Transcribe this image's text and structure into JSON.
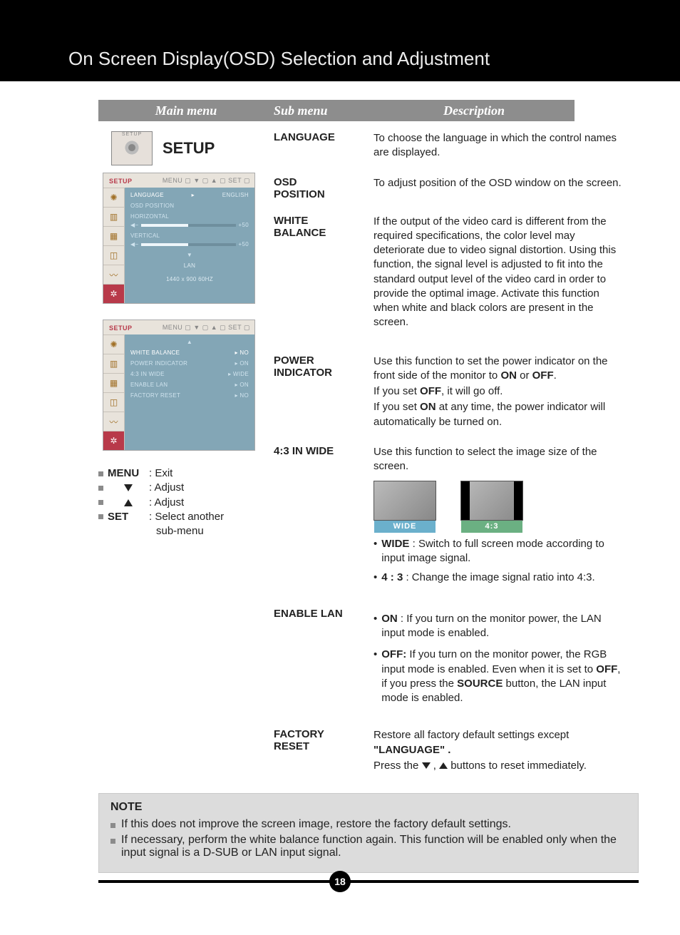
{
  "banner_title": "On Screen Display(OSD) Selection and Adjustment",
  "columns": {
    "main": "Main menu",
    "sub": "Sub menu",
    "desc": "Description"
  },
  "setup": {
    "icon_label": "SETUP",
    "title": "SETUP",
    "panel1": {
      "title": "SETUP",
      "nav": "MENU ▢  ▼ ▢  ▲ ▢  SET ▢",
      "rows": {
        "language": {
          "label": "LANGUAGE",
          "value": "ENGLISH"
        },
        "osd_position": "OSD  POSITION",
        "horizontal": "HORIZONTAL",
        "h_val": "50",
        "vertical": "VERTICAL",
        "v_val": "50",
        "lan": "LAN",
        "res": "1440 x 900  60HZ"
      }
    },
    "panel2": {
      "title": "SETUP",
      "nav": "MENU ▢  ▼ ▢  ▲ ▢  SET ▢",
      "rows": {
        "white_balance": {
          "label": "WHITE  BALANCE",
          "value": "NO"
        },
        "power_indicator": {
          "label": "POWER  INDICATOR",
          "value": "ON"
        },
        "ratio": {
          "label": "4:3 IN WIDE",
          "value": "WIDE"
        },
        "enable_lan": {
          "label": "ENABLE  LAN",
          "value": "ON"
        },
        "factory_reset": {
          "label": "FACTORY  RESET",
          "value": "NO"
        }
      }
    },
    "legend": {
      "menu": {
        "key": "MENU",
        "desc": ": Exit"
      },
      "down": {
        "desc": ": Adjust"
      },
      "up": {
        "desc": ": Adjust"
      },
      "set": {
        "key": "SET",
        "desc": ": Select another",
        "desc2": "sub-menu"
      }
    }
  },
  "items": {
    "language": {
      "title": "LANGUAGE",
      "desc": "To choose the language in which the control names are displayed."
    },
    "osd_position": {
      "title": "OSD POSITION",
      "desc": "To adjust position of the OSD window on the screen."
    },
    "white_balance": {
      "title": "WHITE BALANCE",
      "desc": "If the output of the video card is different from the required specifications, the color level may deteriorate due to video signal distortion. Using this function, the signal level is adjusted to fit into the standard output level of the video card in order to provide the optimal image. Activate this function when white and black colors are present in the screen."
    },
    "power_indicator": {
      "title": "POWER INDICATOR",
      "l1a": "Use this function to set the power indicator on the front side of the monitor to ",
      "l1b": "ON",
      "l1c": " or ",
      "l1d": "OFF",
      "l1e": ".",
      "l2a": "If you set ",
      "l2b": "OFF",
      "l2c": ", it will go off.",
      "l3a": "If you set ",
      "l3b": "ON",
      "l3c": " at any time, the power indicator will automatically be turned on."
    },
    "ratio": {
      "title": "4:3 IN WIDE",
      "desc": "Use this function to select the image size of the screen.",
      "wide_label": "WIDE",
      "four3_label": "4:3",
      "wide_key": "WIDE",
      "wide_text": " : Switch to full screen mode according to input image signal.",
      "four3_key": "4 : 3",
      "four3_text": " : Change the image signal ratio into 4:3."
    },
    "enable_lan": {
      "title": "ENABLE LAN",
      "on_key": "ON",
      "on_text": " : If you turn on the monitor power, the LAN input mode is enabled.",
      "off_key": "OFF:",
      "off_t1": " If you turn on the monitor power, the RGB input mode is enabled. Even when it is set to ",
      "off_b1": "OFF",
      "off_t2": ", if you press the ",
      "off_b2": "SOURCE",
      "off_t3": " button, the LAN input mode is enabled."
    },
    "factory_reset": {
      "title": "FACTORY RESET",
      "l1a": "Restore all factory default settings except ",
      "l1b": "\"LANGUAGE\" .",
      "l2a": "Press the ",
      "l2b": " buttons to reset immediately."
    }
  },
  "note": {
    "title": "NOTE",
    "li1": "If this does not improve the screen image, restore the factory default settings.",
    "li2": "If necessary, perform the white balance function again. This function will be enabled only when the input signal is a D-SUB or LAN input signal."
  },
  "page_number": "18"
}
